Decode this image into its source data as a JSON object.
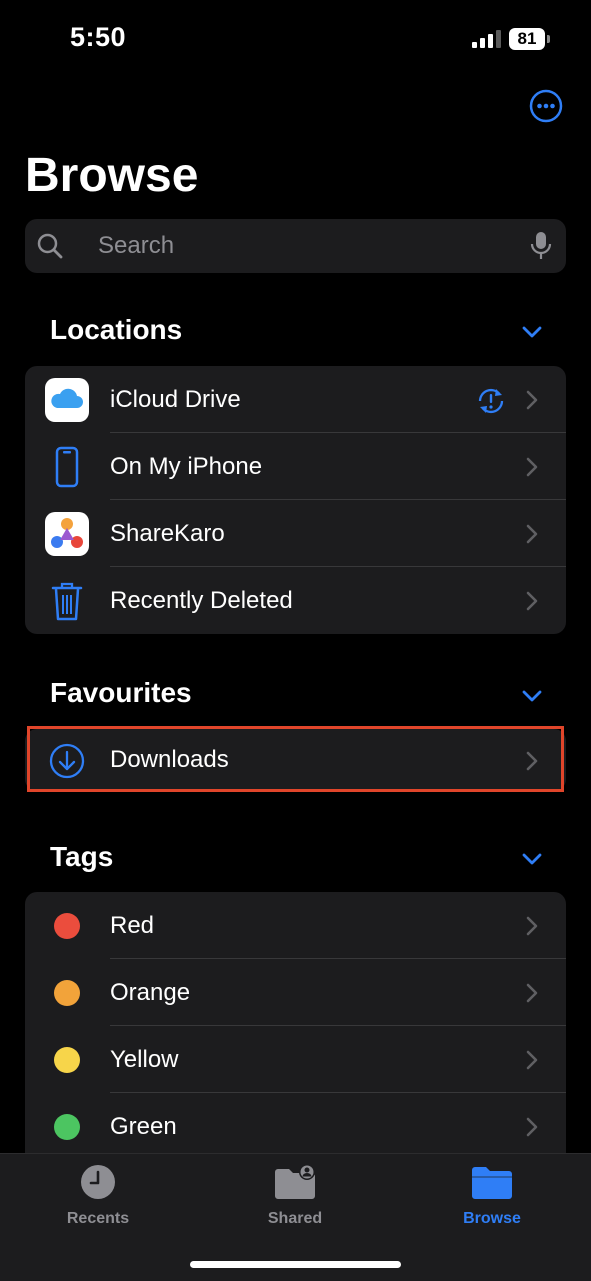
{
  "status": {
    "time": "5:50",
    "battery": "81"
  },
  "header": {
    "title": "Browse",
    "more_icon": "ellipsis-circle-icon"
  },
  "search": {
    "placeholder": "Search"
  },
  "locations": {
    "title": "Locations",
    "items": [
      {
        "label": "iCloud Drive",
        "icon": "icloud-icon",
        "status_icon": "sync-warning-icon"
      },
      {
        "label": "On My iPhone",
        "icon": "iphone-icon"
      },
      {
        "label": "ShareKaro",
        "icon": "sharekaro-app-icon"
      },
      {
        "label": "Recently Deleted",
        "icon": "trash-icon"
      }
    ]
  },
  "favourites": {
    "title": "Favourites",
    "items": [
      {
        "label": "Downloads",
        "icon": "download-icon"
      }
    ]
  },
  "tags": {
    "title": "Tags",
    "items": [
      {
        "label": "Red",
        "color": "#eb4d3d"
      },
      {
        "label": "Orange",
        "color": "#f2a33a"
      },
      {
        "label": "Yellow",
        "color": "#f7d54a"
      },
      {
        "label": "Green",
        "color": "#4cc561"
      }
    ]
  },
  "tabbar": {
    "tabs": [
      {
        "label": "Recents",
        "icon": "clock-icon",
        "active": false
      },
      {
        "label": "Shared",
        "icon": "shared-folder-icon",
        "active": false
      },
      {
        "label": "Browse",
        "icon": "folder-icon",
        "active": true
      }
    ]
  },
  "colors": {
    "accent": "#2f7ef6",
    "highlight_border": "#e0452a",
    "group_bg": "#1c1c1e"
  }
}
